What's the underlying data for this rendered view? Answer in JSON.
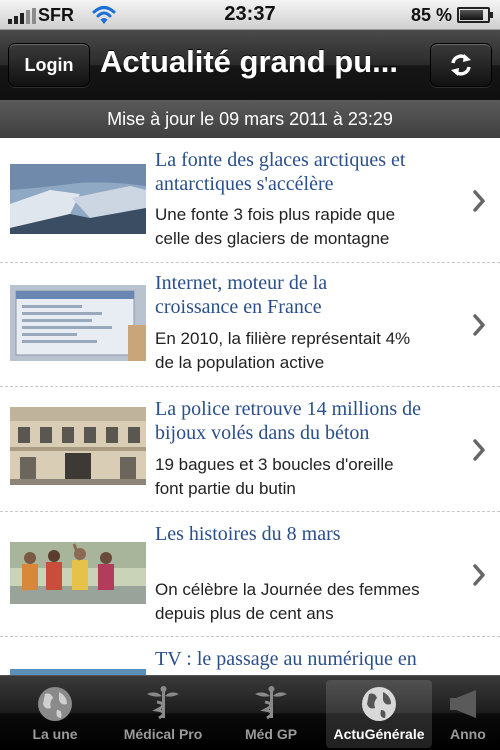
{
  "status_bar": {
    "carrier": "SFR",
    "time": "23:37",
    "battery_percent": "85 %",
    "battery_level": 0.85
  },
  "nav": {
    "login_label": "Login",
    "title": "Actualité grand pu..."
  },
  "update_text": "Mise à jour le 09 mars 2011 à 23:29",
  "articles": [
    {
      "headline_1": "La fonte des glaces arctiques et",
      "headline_2": "antarctiques s'accélère",
      "summary_1": "Une fonte 3 fois plus rapide que",
      "summary_2": "celle des glaciers de montagne"
    },
    {
      "headline_1": "Internet, moteur de la",
      "headline_2": "croissance en France",
      "summary_1": "En 2010, la filière représentait 4%",
      "summary_2": "de la population active"
    },
    {
      "headline_1": "La police retrouve 14 millions de",
      "headline_2": "bijoux volés dans du béton",
      "summary_1": "19 bagues et 3 boucles d'oreille",
      "summary_2": "font partie du butin"
    },
    {
      "headline_1": "Les histoires du 8 mars",
      "headline_2": "",
      "summary_1": "On célèbre la Journée des femmes",
      "summary_2": "depuis plus de cent ans"
    },
    {
      "headline_1": "TV : le passage au numérique en",
      "headline_2": "",
      "summary_1": "",
      "summary_2": ""
    }
  ],
  "tabs": [
    {
      "label": "La une",
      "icon": "globe-icon",
      "active": false
    },
    {
      "label": "Médical Pro",
      "icon": "caduceus-icon",
      "active": false
    },
    {
      "label": "Méd GP",
      "icon": "caduceus-icon",
      "active": false
    },
    {
      "label": "ActuGénérale",
      "icon": "globe-icon",
      "active": true
    },
    {
      "label": "Anno",
      "icon": "megaphone-icon",
      "active": false
    }
  ],
  "colors": {
    "headline": "#2a4f8a",
    "nav_bar": "#1c1c1c",
    "tab_bar": "#0a0a0a"
  }
}
